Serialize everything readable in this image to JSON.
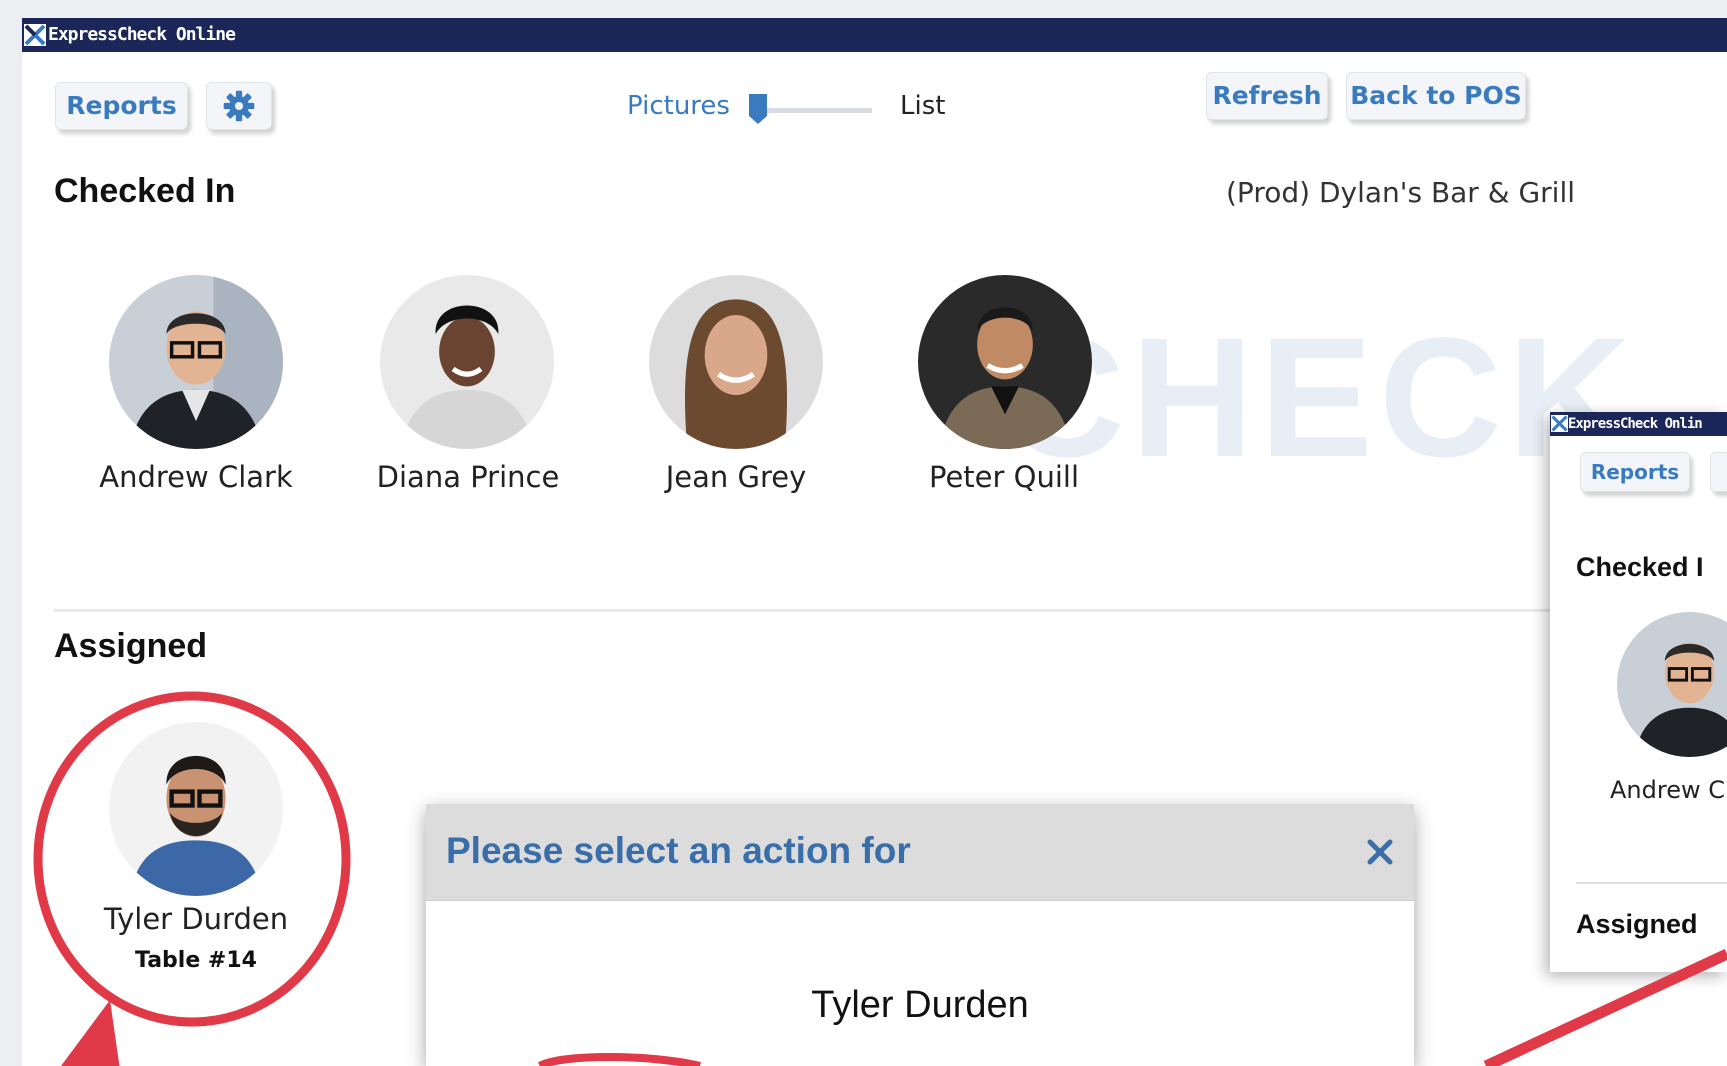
{
  "app": {
    "title": "ExpressCheck Online"
  },
  "toolbar": {
    "reports_label": "Reports",
    "settings_icon": "gear-icon",
    "view_toggle": {
      "left_label": "Pictures",
      "right_label": "List",
      "value": 0
    },
    "refresh_label": "Refresh",
    "back_label": "Back to POS"
  },
  "venue": "(Prod) Dylan's Bar & Grill",
  "watermark": "CHECK",
  "checked_in": {
    "title": "Checked In",
    "people": [
      {
        "name": "Andrew Clark"
      },
      {
        "name": "Diana Prince"
      },
      {
        "name": "Jean Grey"
      },
      {
        "name": "Peter Quill"
      }
    ]
  },
  "assigned": {
    "title": "Assigned",
    "people": [
      {
        "name": "Tyler Durden",
        "table": "Table #14"
      }
    ]
  },
  "dialog": {
    "title": "Please select an action for",
    "close_icon": "close-icon",
    "person_name": "Tyler Durden"
  },
  "inset": {
    "title": "ExpressCheck Onlin",
    "reports_label": "Reports",
    "checked_in_title": "Checked I",
    "person_name": "Andrew C",
    "assigned_title": "Assigned"
  },
  "colors": {
    "titlebar": "#1b2659",
    "accent": "#3a7bc0",
    "annotation": "#e03a48"
  }
}
